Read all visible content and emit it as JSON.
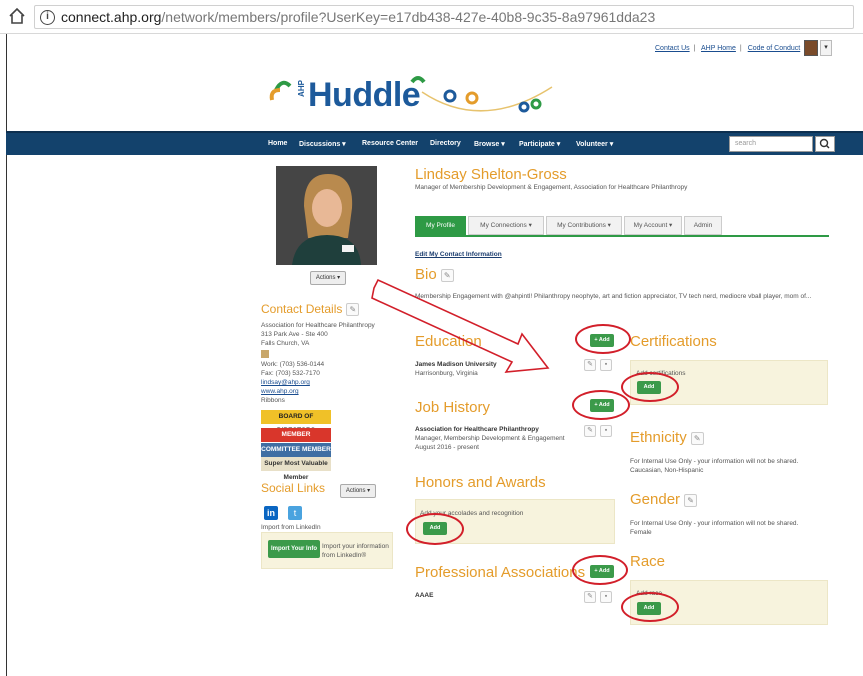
{
  "browser": {
    "url_host": "connect.ahp.org",
    "url_path": "/network/members/profile?UserKey=e17db438-427e-40b8-9c35-8a97961dda23"
  },
  "toplinks": {
    "contact": "Contact Us",
    "home": "AHP Home",
    "conduct": "Code of Conduct"
  },
  "logo": {
    "text": "Huddle",
    "ahp": "AHP"
  },
  "nav": {
    "items": [
      "Home",
      "Discussions ▾",
      "Resource Center",
      "Directory",
      "Browse ▾",
      "Participate ▾",
      "Volunteer ▾"
    ],
    "search_placeholder": "search"
  },
  "profile": {
    "name": "Lindsay Shelton-Gross",
    "title": "Manager of Membership Development & Engagement, Association for Healthcare Philanthropy",
    "actions": "Actions ▾",
    "tabs": [
      "My Profile",
      "My Connections ▾",
      "My Contributions ▾",
      "My Account ▾",
      "Admin"
    ],
    "edit_contact": "Edit My Contact Information"
  },
  "bio": {
    "heading": "Bio",
    "text": "Membership Engagement with @ahpintl! Philanthropy neophyte, art and fiction appreciator, TV tech nerd, mediocre vball player, mom of..."
  },
  "contact": {
    "heading": "Contact Details",
    "org": "Association for Healthcare Philanthropy",
    "addr1": "313 Park Ave - Ste 400",
    "addr2": "Falls Church, VA",
    "work": "Work: (703) 536-0144",
    "fax": "Fax: (703) 532-7170",
    "email": "lindsay@ahp.org",
    "web": "www.ahp.org",
    "ribbons_label": "Ribbons",
    "ribbons": [
      "BOARD OF DIRECTORS",
      "MEMBER AMBASSADOR",
      "COMMITTEE MEMBER",
      "Super Most Valuable Member"
    ]
  },
  "social": {
    "heading": "Social Links",
    "actions": "Actions ▾",
    "import_label": "Import from LinkedIn",
    "import_button": "Import Your Info",
    "import_text": "Import your information from LinkedIn®"
  },
  "education": {
    "heading": "Education",
    "add": "Add",
    "school": "James Madison University",
    "location": "Harrisonburg, Virginia"
  },
  "job": {
    "heading": "Job History",
    "add": "Add",
    "org": "Association for Healthcare Philanthropy",
    "role": "Manager, Membership Development & Engagement",
    "dates": "August 2016 - present"
  },
  "honors": {
    "heading": "Honors and Awards",
    "add": "Add",
    "prompt": "Add your accolades and recognition"
  },
  "prof": {
    "heading": "Professional Associations",
    "add": "Add",
    "item": "AAAE"
  },
  "cert": {
    "heading": "Certifications",
    "add": "Add",
    "prompt": "Add certifications"
  },
  "ethnicity": {
    "heading": "Ethnicity",
    "note": "For Internal Use Only - your information will not be shared.",
    "value": "Caucasian, Non-Hispanic"
  },
  "gender": {
    "heading": "Gender",
    "note": "For Internal Use Only - your information will not be shared.",
    "value": "Female"
  },
  "race": {
    "heading": "Race",
    "add": "Add",
    "prompt": "Add race"
  },
  "colors": {
    "accent": "#e49c2b",
    "nav": "#13426c",
    "green": "#2e9a45",
    "annotation": "#d21f2a"
  }
}
